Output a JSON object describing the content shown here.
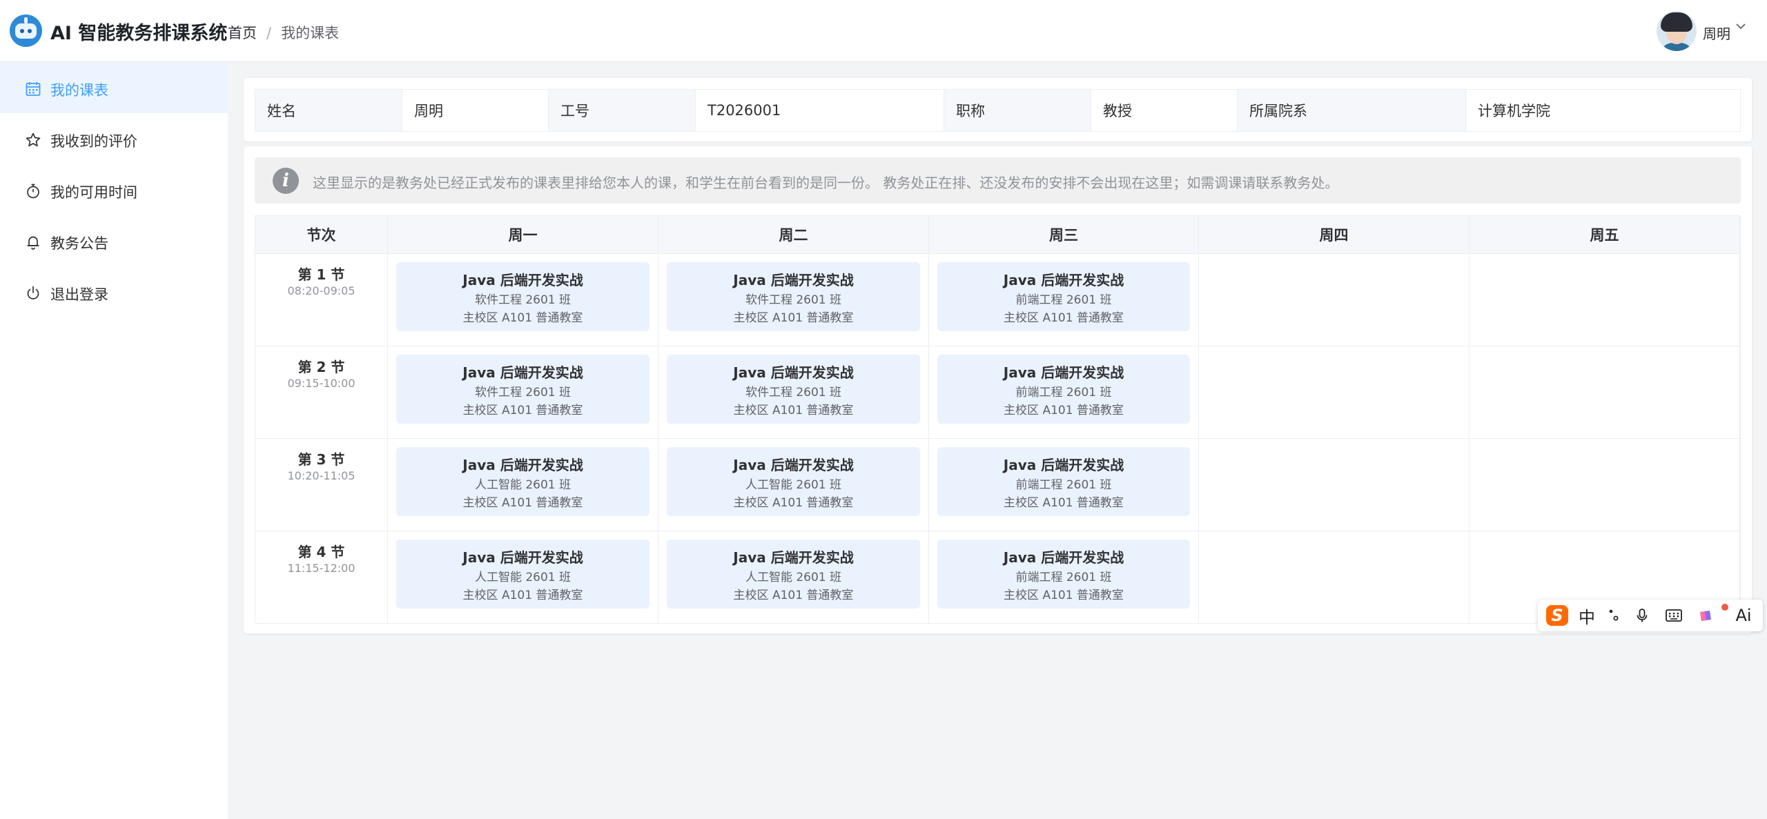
{
  "app": {
    "title": "AI 智能教务排课系统"
  },
  "breadcrumb": {
    "home": "首页",
    "separator": "/",
    "current": "我的课表"
  },
  "user": {
    "name": "周明"
  },
  "sidebar": {
    "items": [
      {
        "label": "我的课表",
        "icon": "calendar-icon",
        "active": true
      },
      {
        "label": "我收到的评价",
        "icon": "star-icon",
        "active": false
      },
      {
        "label": "我的可用时间",
        "icon": "stopwatch-icon",
        "active": false
      },
      {
        "label": "教务公告",
        "icon": "bell-icon",
        "active": false
      },
      {
        "label": "退出登录",
        "icon": "power-icon",
        "active": false
      }
    ]
  },
  "teacher_info": {
    "name_label": "姓名",
    "name_value": "周明",
    "id_label": "工号",
    "id_value": "T2026001",
    "title_label": "职称",
    "title_value": "教授",
    "dept_label": "所属院系",
    "dept_value": "计算机学院"
  },
  "notice": {
    "text": "这里显示的是教务处已经正式发布的课表里排给您本人的课，和学生在前台看到的是同一份。 教务处正在排、还没发布的安排不会出现在这里；如需调课请联系教务处。"
  },
  "schedule": {
    "headers": [
      "节次",
      "周一",
      "周二",
      "周三",
      "周四",
      "周五"
    ],
    "periods": [
      {
        "name": "第 1 节",
        "time": "08:20-09:05",
        "days": [
          {
            "course": "Java 后端开发实战",
            "class": "软件工程 2601 班",
            "room": "主校区 A101 普通教室"
          },
          {
            "course": "Java 后端开发实战",
            "class": "软件工程 2601 班",
            "room": "主校区 A101 普通教室"
          },
          {
            "course": "Java 后端开发实战",
            "class": "前端工程 2601 班",
            "room": "主校区 A101 普通教室"
          },
          null,
          null
        ]
      },
      {
        "name": "第 2 节",
        "time": "09:15-10:00",
        "days": [
          {
            "course": "Java 后端开发实战",
            "class": "软件工程 2601 班",
            "room": "主校区 A101 普通教室"
          },
          {
            "course": "Java 后端开发实战",
            "class": "软件工程 2601 班",
            "room": "主校区 A101 普通教室"
          },
          {
            "course": "Java 后端开发实战",
            "class": "前端工程 2601 班",
            "room": "主校区 A101 普通教室"
          },
          null,
          null
        ]
      },
      {
        "name": "第 3 节",
        "time": "10:20-11:05",
        "days": [
          {
            "course": "Java 后端开发实战",
            "class": "人工智能 2601 班",
            "room": "主校区 A101 普通教室"
          },
          {
            "course": "Java 后端开发实战",
            "class": "人工智能 2601 班",
            "room": "主校区 A101 普通教室"
          },
          {
            "course": "Java 后端开发实战",
            "class": "前端工程 2601 班",
            "room": "主校区 A101 普通教室"
          },
          null,
          null
        ]
      },
      {
        "name": "第 4 节",
        "time": "11:15-12:00",
        "days": [
          {
            "course": "Java 后端开发实战",
            "class": "人工智能 2601 班",
            "room": "主校区 A101 普通教室"
          },
          {
            "course": "Java 后端开发实战",
            "class": "人工智能 2601 班",
            "room": "主校区 A101 普通教室"
          },
          {
            "course": "Java 后端开发实战",
            "class": "前端工程 2601 班",
            "room": "主校区 A101 普通教室"
          },
          null,
          null
        ]
      }
    ]
  },
  "ime_toolbar": {
    "mode_label": "中",
    "logo_letter": "S",
    "ai_label": "Ai"
  },
  "colors": {
    "accent": "#409eff",
    "course_bg": "#eaf2fd",
    "ime_brand": "#ff6a00"
  }
}
